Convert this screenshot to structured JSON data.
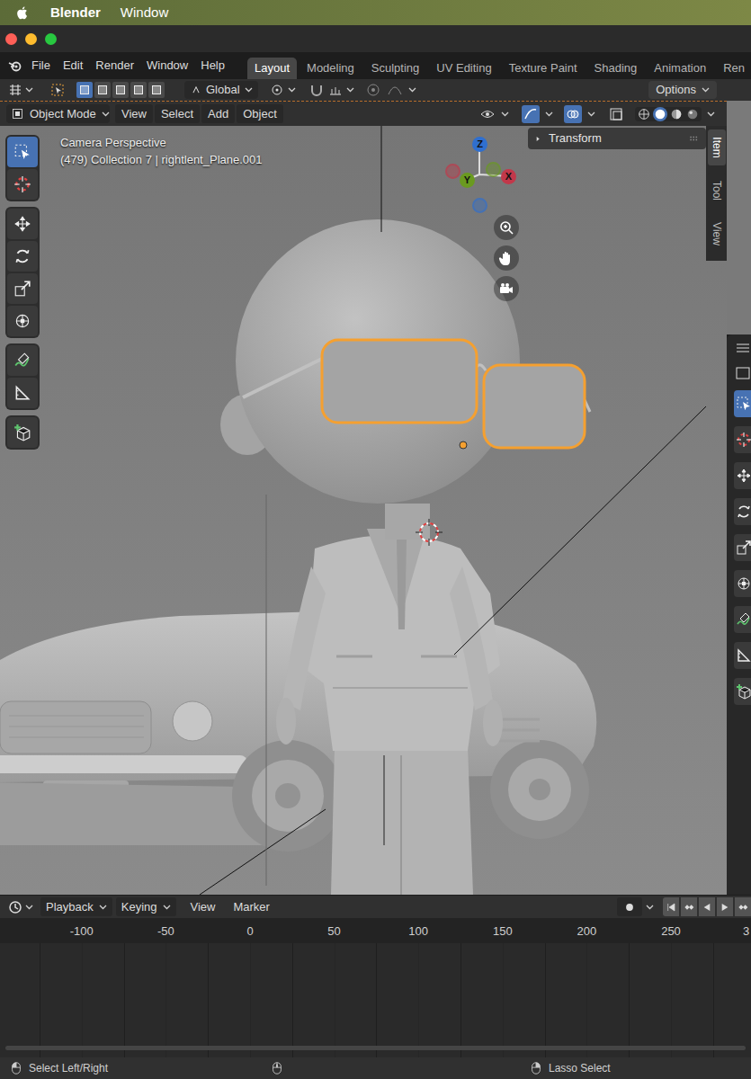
{
  "os_menubar": {
    "app": "Blender",
    "items": [
      "Window"
    ]
  },
  "app_menu": [
    "File",
    "Edit",
    "Render",
    "Window",
    "Help"
  ],
  "workspace_tabs": [
    {
      "label": "Layout",
      "selected": true
    },
    {
      "label": "Modeling",
      "selected": false
    },
    {
      "label": "Sculpting",
      "selected": false
    },
    {
      "label": "UV Editing",
      "selected": false
    },
    {
      "label": "Texture Paint",
      "selected": false
    },
    {
      "label": "Shading",
      "selected": false
    },
    {
      "label": "Animation",
      "selected": false
    },
    {
      "label": "Ren",
      "selected": false
    }
  ],
  "tool_header": {
    "orientation": "Global",
    "options": "Options"
  },
  "viewport_header": {
    "mode": "Object Mode",
    "menus": [
      "View",
      "Select",
      "Add",
      "Object"
    ]
  },
  "toolbar": [
    {
      "kind": "select",
      "selected": true
    },
    {
      "kind": "cursor",
      "selected": false
    },
    {
      "kind": "move",
      "selected": false
    },
    {
      "kind": "rotate",
      "selected": false
    },
    {
      "kind": "scale",
      "selected": false
    },
    {
      "kind": "transform",
      "selected": false
    },
    {
      "kind": "annotate",
      "selected": false
    },
    {
      "kind": "measure",
      "selected": false
    },
    {
      "kind": "addcube",
      "selected": false
    }
  ],
  "viewport": {
    "view": "Camera Perspective",
    "info": "(479) Collection 7 | rightlent_Plane.001",
    "gizmo": [
      {
        "label": "Z",
        "color": "#2f6fcf"
      },
      {
        "label": "Y",
        "color": "#6a9a1f"
      },
      {
        "label": "X",
        "color": "#c2384a"
      }
    ],
    "navigation": [
      {
        "kind": "zoom"
      },
      {
        "kind": "pan"
      },
      {
        "kind": "camera"
      }
    ]
  },
  "sidebar": {
    "panel": "Transform",
    "tabs": [
      {
        "label": "Item",
        "selected": true
      },
      {
        "label": "Tool",
        "selected": false
      },
      {
        "label": "View",
        "selected": false
      }
    ]
  },
  "timeline": {
    "menus": [
      {
        "label": "Playback",
        "kind": "dropdown"
      },
      {
        "label": "Keying",
        "kind": "dropdown"
      },
      {
        "label": "View",
        "kind": "menu"
      },
      {
        "label": "Marker",
        "kind": "menu"
      }
    ],
    "ticks": [
      "-100",
      "-50",
      "0",
      "50",
      "100",
      "150",
      "200",
      "250",
      "3"
    ]
  },
  "status_bar": [
    "Select Left/Right",
    "Lasso Select"
  ]
}
